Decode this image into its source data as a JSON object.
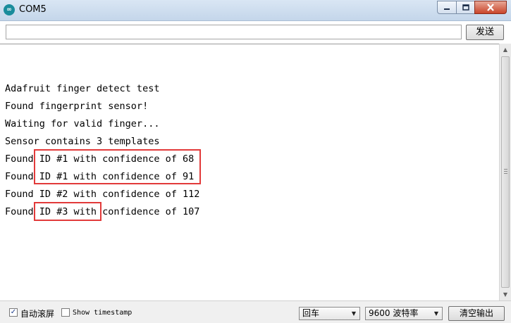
{
  "window": {
    "title": "COM5",
    "app_icon": "arduino-infinity-icon",
    "buttons": [
      "minimize-icon",
      "maximize-icon",
      "close-icon"
    ]
  },
  "send_row": {
    "input_value": "",
    "send_label": "发送"
  },
  "output": {
    "lines": [
      "Adafruit finger detect test",
      "Found fingerprint sensor!",
      "Waiting for valid finger...",
      "Sensor contains 3 templates",
      "Found ID #1 with confidence of 68",
      "Found ID #1 with confidence of 91",
      "Found ID #2 with confidence of 112",
      "Found ID #3 with confidence of 107"
    ],
    "highlight_color": "#e23a3a"
  },
  "status_bar": {
    "autoscroll": {
      "label": "自动滚屏",
      "checked": true
    },
    "timestamp": {
      "label": "Show timestamp",
      "checked": false
    },
    "line_ending": "回车",
    "baud_rate": "9600 波特率",
    "clear_label": "清空输出"
  }
}
